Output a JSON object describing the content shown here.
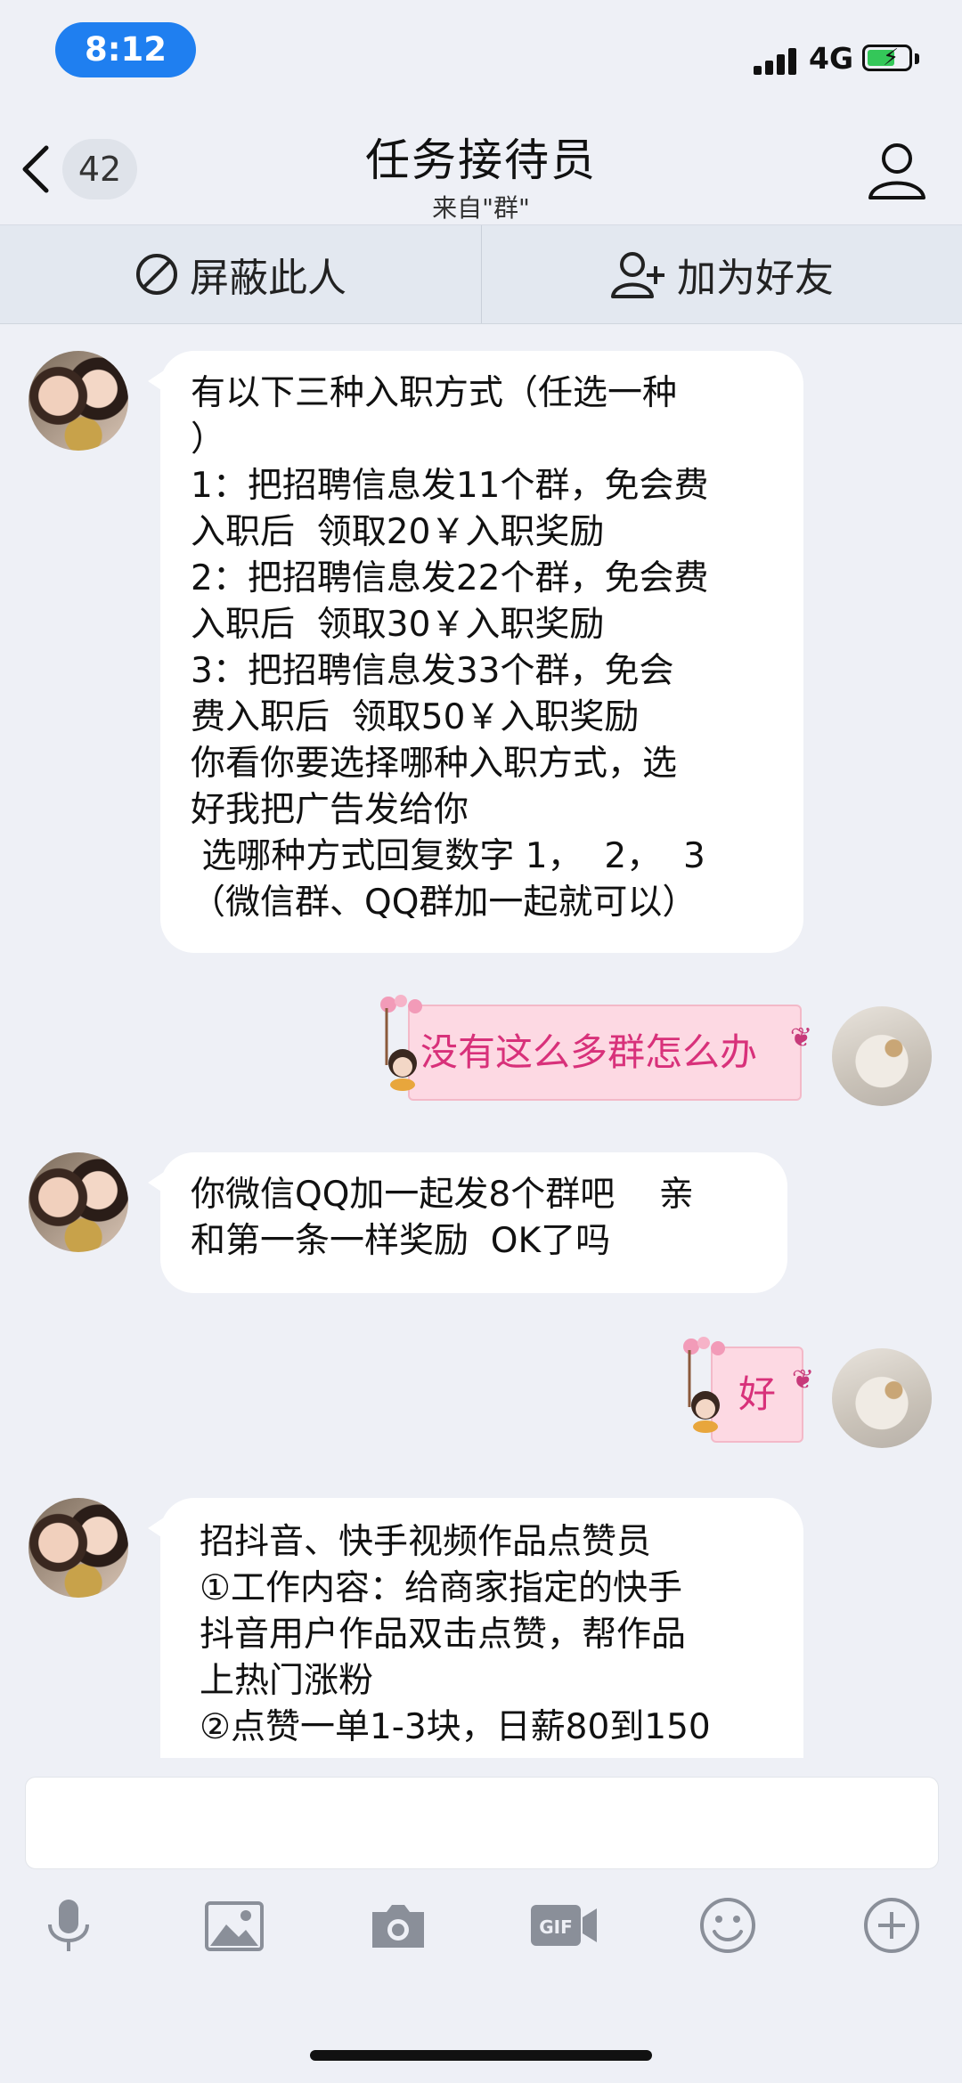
{
  "status": {
    "time": "8:12",
    "network": "4G"
  },
  "header": {
    "unread_count": "42",
    "title": "任务接待员",
    "subtitle": "来自\"群\""
  },
  "actions": {
    "block_label": "屏蔽此人",
    "add_friend_label": "加为好友"
  },
  "messages": [
    {
      "sender": "other",
      "text": "有以下三种入职方式（任选一种\n）\n1：把招聘信息发11个群，免会费\n入职后  领取20￥入职奖励\n2：把招聘信息发22个群，免会费\n入职后  领取30￥入职奖励\n3：把招聘信息发33个群，免会\n费入职后  领取50￥入职奖励\n你看你要选择哪种入职方式，选\n好我把广告发给你\n 选哪种方式回复数字 1，  2，  3\n（微信群、QQ群加一起就可以）"
    },
    {
      "sender": "me",
      "text": "没有这么多群怎么办"
    },
    {
      "sender": "other",
      "text": "你微信QQ加一起发8个群吧    亲\n和第一条一样奖励  OK了吗"
    },
    {
      "sender": "me",
      "text": "好"
    },
    {
      "sender": "other",
      "text": "招抖音、快手视频作品点赞员\n①工作内容：给商家指定的快手\n抖音用户作品双击点赞，帮作品\n上热门涨粉\n②点赞一单1-3块，日薪80到150"
    }
  ],
  "input": {
    "placeholder": ""
  },
  "toolbar": [
    "microphone-icon",
    "image-icon",
    "camera-icon",
    "gif-icon",
    "emoji-icon",
    "plus-icon"
  ],
  "colors": {
    "time_pill": "#1f7ff0",
    "pink_bubble": "#fdd9e3",
    "pink_text": "#d8317a",
    "background": "#eef0f6"
  }
}
